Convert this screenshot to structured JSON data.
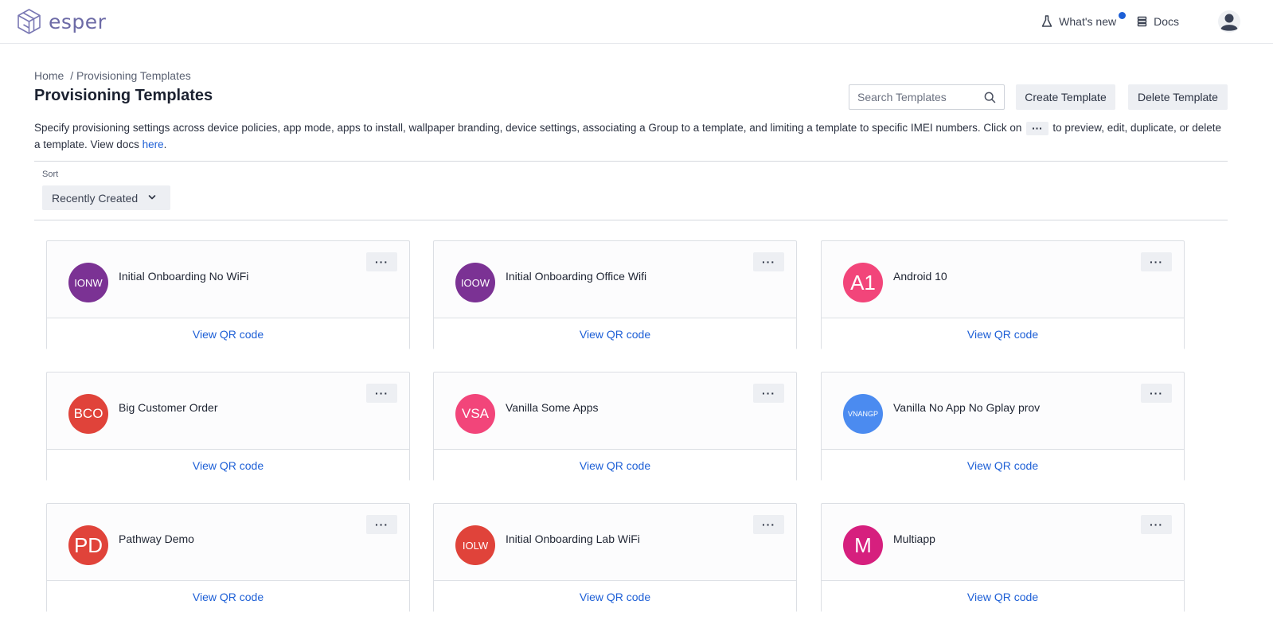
{
  "app": {
    "logo_text": "esper",
    "whats_new_label": "What's new",
    "docs_label": "Docs"
  },
  "breadcrumb": {
    "home": "Home",
    "current": "/ Provisioning Templates"
  },
  "page": {
    "title": "Provisioning Templates",
    "search_placeholder": "Search Templates",
    "create_label": "Create Template",
    "delete_label": "Delete Template",
    "description_part1": "Specify provisioning settings across device policies, app mode, apps to install, wallpaper branding, device settings, associating a Group to a template, and limiting a template to specific IMEI numbers. Click on",
    "description_chip": "···",
    "description_part2": "to preview, edit, duplicate, or delete a template. View docs",
    "description_link": "here",
    "description_end": "."
  },
  "sort": {
    "label": "Sort",
    "value": "Recently Created"
  },
  "cards": [
    {
      "initials": "IONW",
      "name": "Initial Onboarding No WiFi",
      "color": "#7b3294",
      "menu": "···",
      "footer": "View QR code"
    },
    {
      "initials": "IOOW",
      "name": "Initial Onboarding Office Wifi",
      "color": "#7b3294",
      "menu": "···",
      "footer": "View QR code"
    },
    {
      "initials": "A1",
      "name": "Android 10",
      "color": "#f2457a",
      "menu": "···",
      "footer": "View QR code"
    },
    {
      "initials": "BCO",
      "name": "Big Customer Order",
      "color": "#e0433a",
      "menu": "···",
      "footer": "View QR code"
    },
    {
      "initials": "VSA",
      "name": "Vanilla Some Apps",
      "color": "#f2457a",
      "menu": "···",
      "footer": "View QR code"
    },
    {
      "initials": "VNANGP",
      "name": "Vanilla No App No Gplay prov",
      "color": "#4b8bf0",
      "menu": "···",
      "footer": "View QR code"
    },
    {
      "initials": "PD",
      "name": "Pathway Demo",
      "color": "#e0433a",
      "menu": "···",
      "footer": "View QR code"
    },
    {
      "initials": "IOLW",
      "name": "Initial Onboarding Lab WiFi",
      "color": "#e0433a",
      "menu": "···",
      "footer": "View QR code"
    },
    {
      "initials": "M",
      "name": "Multiapp",
      "color": "#d61f7e",
      "menu": "···",
      "footer": "View QR code"
    }
  ]
}
